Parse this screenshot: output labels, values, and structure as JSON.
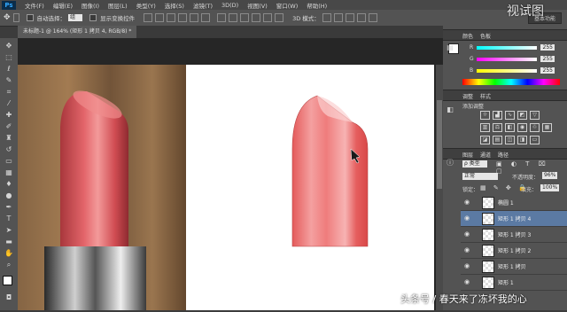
{
  "app": {
    "logo": "Ps"
  },
  "menu": [
    "文件(F)",
    "编辑(E)",
    "图像(I)",
    "图层(L)",
    "类型(Y)",
    "选择(S)",
    "滤镜(T)",
    "3D(D)",
    "视图(V)",
    "窗口(W)",
    "帮助(H)"
  ],
  "options_bar": {
    "auto_select_label": "自动选择：",
    "auto_select_value": "组",
    "show_transform_label": "显示变换控件",
    "mode_3d_label": "3D 模式：",
    "workspace": "基本功能"
  },
  "document_tab": {
    "title": "未标题-1 @ 164% (矩形 1 拷贝 4, RGB/8) *"
  },
  "color_panel": {
    "tabs": [
      "颜色",
      "色板"
    ],
    "channels": [
      {
        "label": "R",
        "value": "255"
      },
      {
        "label": "G",
        "value": "255"
      },
      {
        "label": "B",
        "value": "255"
      }
    ]
  },
  "adjustments_panel": {
    "tabs": [
      "调整",
      "样式"
    ],
    "title": "添加调整"
  },
  "layers_panel": {
    "tabs": [
      "图层",
      "通道",
      "路径"
    ],
    "filter_label": "ρ 类型",
    "blend_mode": "正常",
    "opacity_label": "不透明度：",
    "opacity_value": "96%",
    "lock_label": "锁定：",
    "fill_label": "填充：",
    "fill_value": "100%",
    "layers": [
      {
        "name": "椭圆 1",
        "selected": false
      },
      {
        "name": "矩形 1 拷贝 4",
        "selected": true
      },
      {
        "name": "矩形 1 拷贝 3",
        "selected": false
      },
      {
        "name": "矩形 1 拷贝 2",
        "selected": false
      },
      {
        "name": "矩形 1 拷贝",
        "selected": false
      },
      {
        "name": "矩形 1",
        "selected": false
      }
    ]
  },
  "watermarks": {
    "top_right": "视试图",
    "bottom": "头条号 / 春天来了冻坏我的心"
  },
  "colors": {
    "lipstick": "#e86a6a",
    "selection": "#5b7aa3"
  }
}
